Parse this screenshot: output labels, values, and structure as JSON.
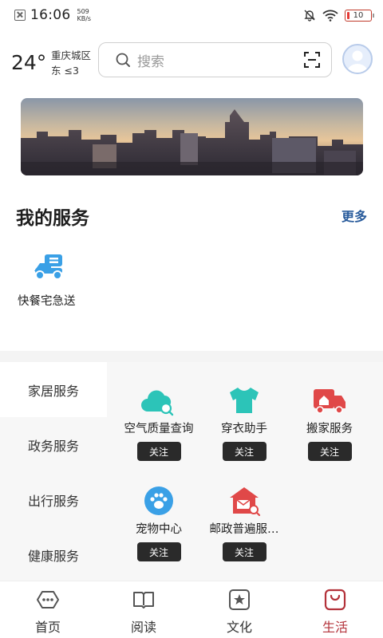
{
  "status_bar": {
    "time": "16:06",
    "speed_value": "509",
    "speed_unit": "KB/s",
    "battery": "10"
  },
  "header": {
    "temperature": "24°",
    "location": "重庆城区",
    "wind": "东  ≤3",
    "search_placeholder": "搜索"
  },
  "my_services": {
    "title": "我的服务",
    "more": "更多",
    "items": [
      {
        "label": "快餐宅急送",
        "icon": "scooter-icon"
      }
    ]
  },
  "categories": [
    "家居服务",
    "政务服务",
    "出行服务",
    "健康服务"
  ],
  "services": [
    {
      "name": "空气质量查询",
      "button": "关注",
      "icon": "cloud-search-icon"
    },
    {
      "name": "穿衣助手",
      "button": "关注",
      "icon": "tshirt-icon"
    },
    {
      "name": "搬家服务",
      "button": "关注",
      "icon": "truck-icon"
    },
    {
      "name": "宠物中心",
      "button": "关注",
      "icon": "paw-icon"
    },
    {
      "name": "邮政普遍服…",
      "button": "关注",
      "icon": "post-office-icon"
    }
  ],
  "bottom_nav": [
    {
      "label": "首页",
      "icon": "home-icon"
    },
    {
      "label": "阅读",
      "icon": "book-icon"
    },
    {
      "label": "文化",
      "icon": "star-frame-icon"
    },
    {
      "label": "生活",
      "icon": "bag-icon",
      "active": true
    }
  ],
  "colors": {
    "accent": "#b3323a",
    "link": "#2a5c9c",
    "teal": "#2cc4b8",
    "blue": "#3aa0e6",
    "red": "#e04848"
  }
}
